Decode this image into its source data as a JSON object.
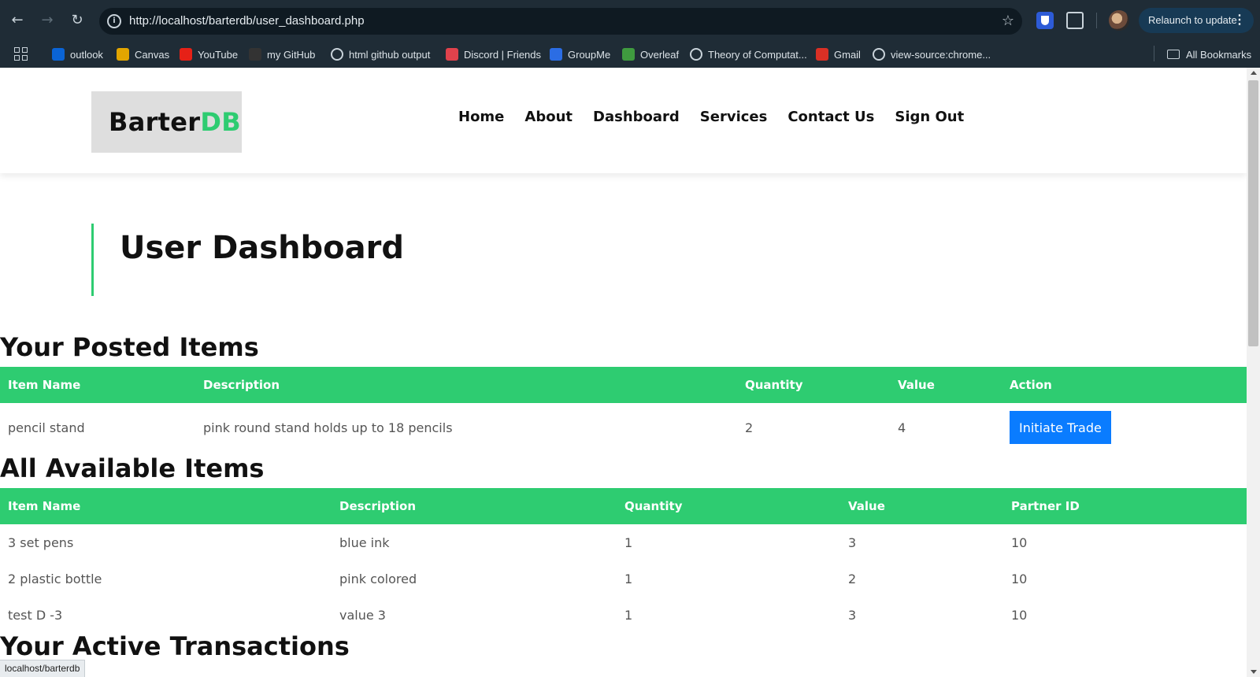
{
  "browser": {
    "url": "http://localhost/barterdb/user_dashboard.php",
    "relaunch_label": "Relaunch to update",
    "bookmarks": [
      {
        "label": "outlook",
        "icon": "outlook-icon",
        "color": "#0a64d6"
      },
      {
        "label": "Canvas",
        "icon": "canvas-icon",
        "color": "#e2a500"
      },
      {
        "label": "YouTube",
        "icon": "youtube-icon",
        "color": "#e62117"
      },
      {
        "label": "my GitHub",
        "icon": "github-icon",
        "color": "#333333"
      },
      {
        "label": "html github output",
        "icon": "globe-icon",
        "color": "#c9d3da"
      },
      {
        "label": "Discord | Friends",
        "icon": "discord-icon",
        "color": "#e0424c"
      },
      {
        "label": "GroupMe",
        "icon": "groupme-icon",
        "color": "#2b6de4"
      },
      {
        "label": "Overleaf",
        "icon": "overleaf-icon",
        "color": "#3f9b3f"
      },
      {
        "label": "Theory of Computat...",
        "icon": "globe-icon",
        "color": "#c9d3da"
      },
      {
        "label": "Gmail",
        "icon": "gmail-icon",
        "color": "#d93025"
      },
      {
        "label": "view-source:chrome...",
        "icon": "globe-icon",
        "color": "#c9d3da"
      }
    ],
    "all_bookmarks_label": "All Bookmarks",
    "status_text": "localhost/barterdb"
  },
  "site": {
    "logo_main": "Barter",
    "logo_accent": "DB",
    "accent_color": "#2ecc71",
    "nav": [
      "Home",
      "About",
      "Dashboard",
      "Services",
      "Contact Us",
      "Sign Out"
    ]
  },
  "page_title": "User Dashboard",
  "posted_items": {
    "heading": "Your Posted Items",
    "columns": [
      "Item Name",
      "Description",
      "Quantity",
      "Value",
      "Action"
    ],
    "rows": [
      {
        "name": "pencil stand",
        "description": "pink round stand holds up to 18 pencils",
        "quantity": "2",
        "value": "4",
        "action": "Initiate Trade"
      }
    ]
  },
  "available_items": {
    "heading": "All Available Items",
    "columns": [
      "Item Name",
      "Description",
      "Quantity",
      "Value",
      "Partner ID"
    ],
    "rows": [
      {
        "name": "3 set pens",
        "description": "blue ink",
        "quantity": "1",
        "value": "3",
        "partner_id": "10"
      },
      {
        "name": "2 plastic bottle",
        "description": "pink colored",
        "quantity": "1",
        "value": "2",
        "partner_id": "10"
      },
      {
        "name": "test D -3",
        "description": "value 3",
        "quantity": "1",
        "value": "3",
        "partner_id": "10"
      }
    ]
  },
  "active_transactions": {
    "heading": "Your Active Transactions"
  }
}
